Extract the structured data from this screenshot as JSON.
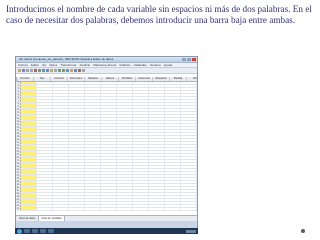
{
  "caption": {
    "text": "Introducimos el nombre de cada variable sin espacios ni más de dos palabras. En el caso de necesitar dos palabras, debemos introducir una barra baja entre ambas."
  },
  "window": {
    "title": "Sin título1 [Conjunto_de_datos0] - IBM SPSS Statistics Editor de datos"
  },
  "menu": [
    "Archivo",
    "Editar",
    "Ver",
    "Datos",
    "Transformar",
    "Analizar",
    "Marketing directo",
    "Gráficos",
    "Utilidades",
    "Ventana",
    "Ayuda"
  ],
  "columns": [
    "Nombre",
    "Tipo",
    "Anchura",
    "Decimales",
    "Etiqueta",
    "Valores",
    "Perdidos",
    "Columnas",
    "Alineación",
    "Medida",
    "Rol"
  ],
  "rows": [
    "1",
    "2",
    "3",
    "4",
    "5",
    "6",
    "7",
    "8",
    "9",
    "10",
    "11",
    "12",
    "13",
    "14",
    "15",
    "16",
    "17",
    "18",
    "19",
    "20",
    "21",
    "22",
    "23",
    "24",
    "25",
    "26",
    "27",
    "28",
    "29",
    "30",
    "31",
    "32",
    "33",
    "34",
    "35",
    "36",
    "37",
    "38",
    "39",
    "40",
    "41",
    "42",
    "43"
  ],
  "selected_column": "Nombre",
  "tabs": [
    "Vista de datos",
    "Vista de variables"
  ],
  "active_tab": "Vista de variables",
  "colors": {
    "caption": "#2f2f86",
    "selected_column": "#fff07a",
    "taskbar": "#1f3552"
  }
}
